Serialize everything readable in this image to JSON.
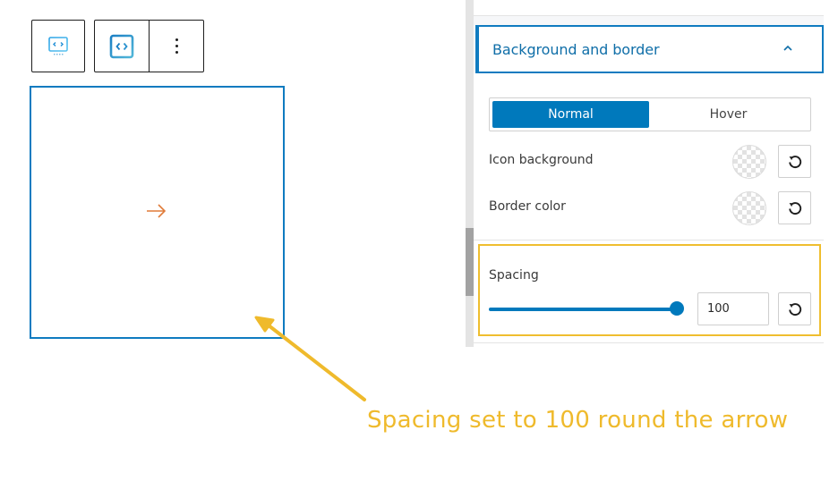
{
  "toolbar": {
    "block_type_button": {
      "icon": "code-block-icon",
      "label": "Block type"
    },
    "block_style_button": {
      "icon": "code-block-outline-icon",
      "label": "Block style"
    },
    "options_button": {
      "icon": "more-vertical-icon",
      "label": "Options"
    }
  },
  "block": {
    "icon": "arrow-right-icon",
    "icon_color": "#e07b39",
    "border_color": "#0f7bc0"
  },
  "sidebar": {
    "section": {
      "title": "Background and border",
      "expanded": true,
      "toggle_icon": "chevron-up-icon"
    },
    "state_tabs": [
      {
        "label": "Normal",
        "active": true
      },
      {
        "label": "Hover",
        "active": false
      }
    ],
    "color_rows": [
      {
        "label": "Icon background",
        "value": "transparent",
        "reset_icon": "reset-icon"
      },
      {
        "label": "Border color",
        "value": "transparent",
        "reset_icon": "reset-icon"
      }
    ],
    "spacing": {
      "label": "Spacing",
      "value": "100",
      "slider_fraction": 1.0,
      "reset_icon": "reset-icon"
    }
  },
  "annotation": {
    "text": "Spacing set to 100 round the arrow",
    "color": "#efba2c"
  }
}
